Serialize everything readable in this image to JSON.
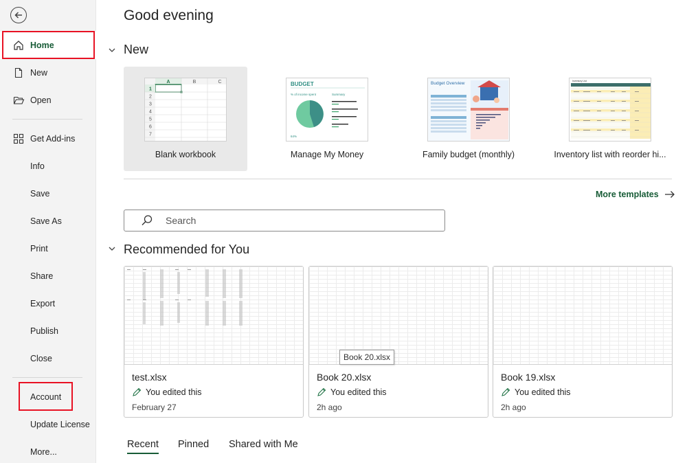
{
  "sidebar": {
    "items": [
      {
        "label": "Home"
      },
      {
        "label": "New"
      },
      {
        "label": "Open"
      },
      {
        "label": "Get Add-ins"
      },
      {
        "label": "Info"
      },
      {
        "label": "Save"
      },
      {
        "label": "Save As"
      },
      {
        "label": "Print"
      },
      {
        "label": "Share"
      },
      {
        "label": "Export"
      },
      {
        "label": "Publish"
      },
      {
        "label": "Close"
      },
      {
        "label": "Account"
      },
      {
        "label": "Update License"
      },
      {
        "label": "More..."
      }
    ]
  },
  "main": {
    "greeting": "Good evening",
    "new_section": "New",
    "templates": [
      {
        "name": "Blank workbook"
      },
      {
        "name": "Manage My Money",
        "thumb_title": "BUDGET",
        "thumb_left": "% of income spent",
        "thumb_right": "Summary",
        "thumb_pct": "64%"
      },
      {
        "name": "Family budget (monthly)",
        "thumb_title": "Budget Overview"
      },
      {
        "name": "Inventory list with reorder hi...",
        "thumb_title": "Inventory List"
      }
    ],
    "blank_grid": {
      "cols": [
        "A",
        "B",
        "C"
      ],
      "rows": [
        "1",
        "2",
        "3",
        "4",
        "5",
        "6",
        "7"
      ]
    },
    "more_templates": "More templates",
    "search_placeholder": "Search",
    "recommended_section": "Recommended for You",
    "recent": [
      {
        "file": "test.xlsx",
        "edited": "You edited this",
        "when": "February 27"
      },
      {
        "file": "Book 20.xlsx",
        "edited": "You edited this",
        "when": "2h ago"
      },
      {
        "file": "Book 19.xlsx",
        "edited": "You edited this",
        "when": "2h ago"
      }
    ],
    "tooltip": "Book 20.xlsx",
    "tabs": [
      {
        "label": "Recent"
      },
      {
        "label": "Pinned"
      },
      {
        "label": "Shared with Me"
      }
    ]
  },
  "colors": {
    "accent": "#185c37",
    "highlight": "#e81123"
  }
}
